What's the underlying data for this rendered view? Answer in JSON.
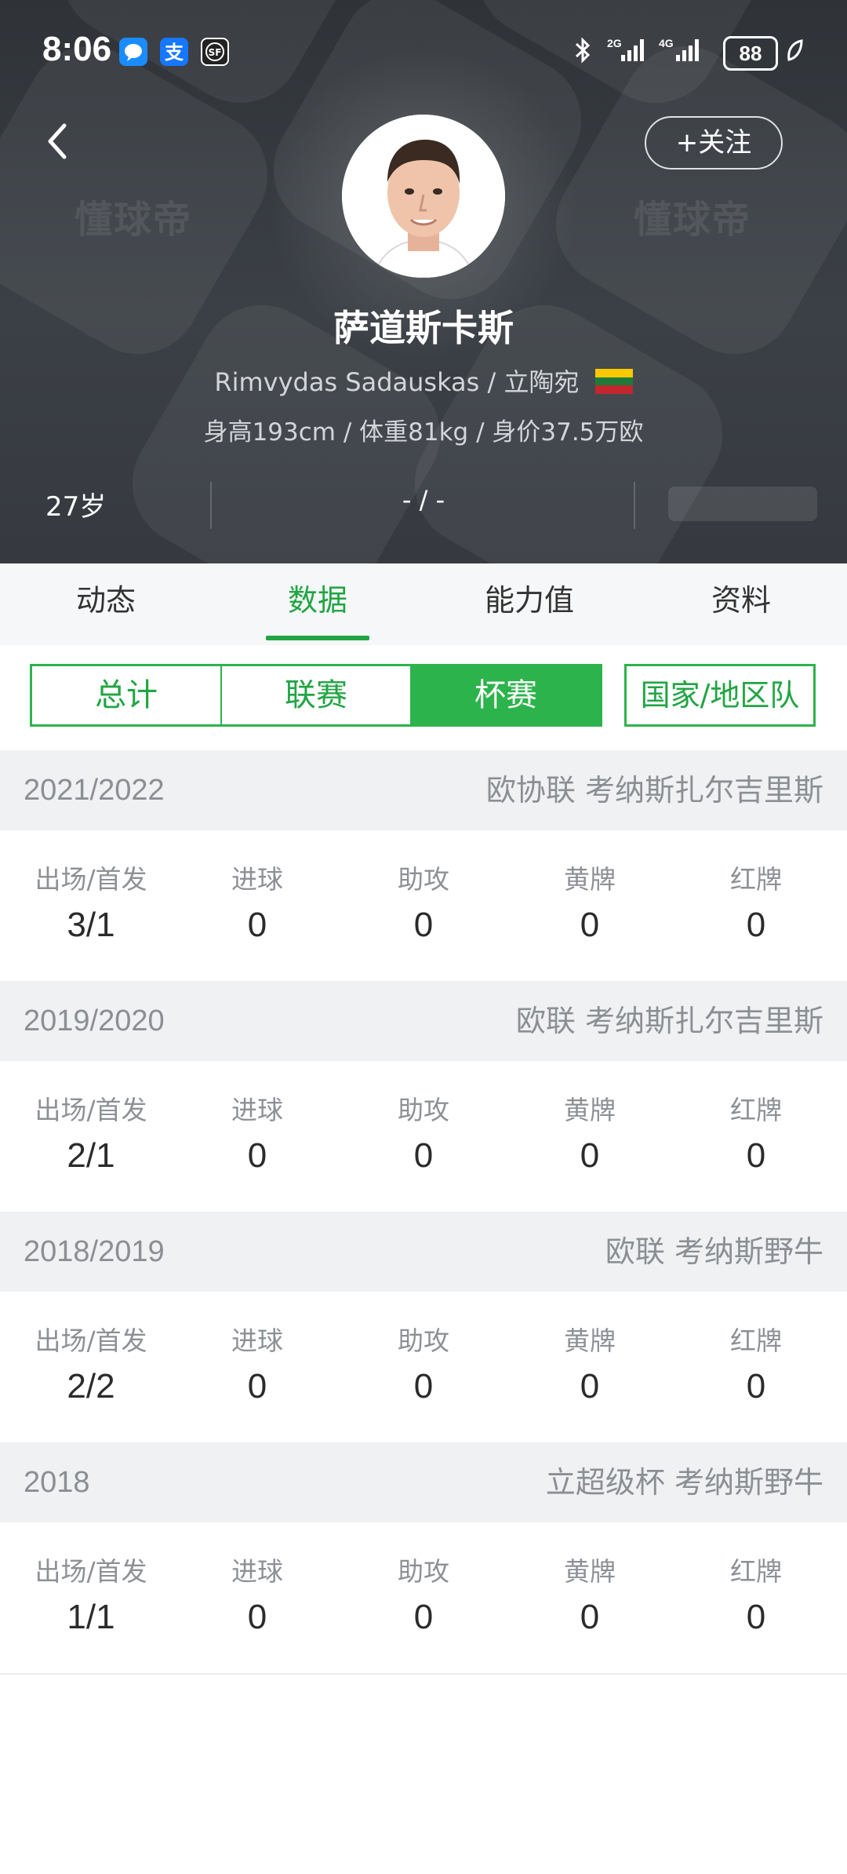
{
  "status_bar": {
    "time": "8:06",
    "battery": "88",
    "network_1": "2G",
    "network_2": "4G"
  },
  "header": {
    "follow_label": "+关注",
    "player_name": "萨道斯卡斯",
    "english_name_country": "Rimvydas Sadauskas / 立陶宛",
    "body_info": "身高193cm / 体重81kg / 身价37.5万欧",
    "age": "27岁",
    "middle_info": "- / -",
    "watermark": "懂球帝",
    "flag_colors": [
      "#f9c900",
      "#1f7a3a",
      "#c1272d"
    ]
  },
  "tabs": [
    "动态",
    "数据",
    "能力值",
    "资料"
  ],
  "active_tab": 1,
  "segments": [
    "总计",
    "联赛",
    "杯赛"
  ],
  "active_segment": 2,
  "national_team_label": "国家/地区队",
  "stat_labels": [
    "出场/首发",
    "进球",
    "助攻",
    "黄牌",
    "红牌"
  ],
  "seasons": [
    {
      "year": "2021/2022",
      "competition": "欧协联 考纳斯扎尔吉里斯",
      "values": [
        "3/1",
        "0",
        "0",
        "0",
        "0"
      ]
    },
    {
      "year": "2019/2020",
      "competition": "欧联 考纳斯扎尔吉里斯",
      "values": [
        "2/1",
        "0",
        "0",
        "0",
        "0"
      ]
    },
    {
      "year": "2018/2019",
      "competition": "欧联 考纳斯野牛",
      "values": [
        "2/2",
        "0",
        "0",
        "0",
        "0"
      ]
    },
    {
      "year": "2018",
      "competition": "立超级杯 考纳斯野牛",
      "values": [
        "1/1",
        "0",
        "0",
        "0",
        "0"
      ]
    }
  ],
  "colors": {
    "accent_green": "#21a543",
    "header_bg": "#33373c"
  }
}
